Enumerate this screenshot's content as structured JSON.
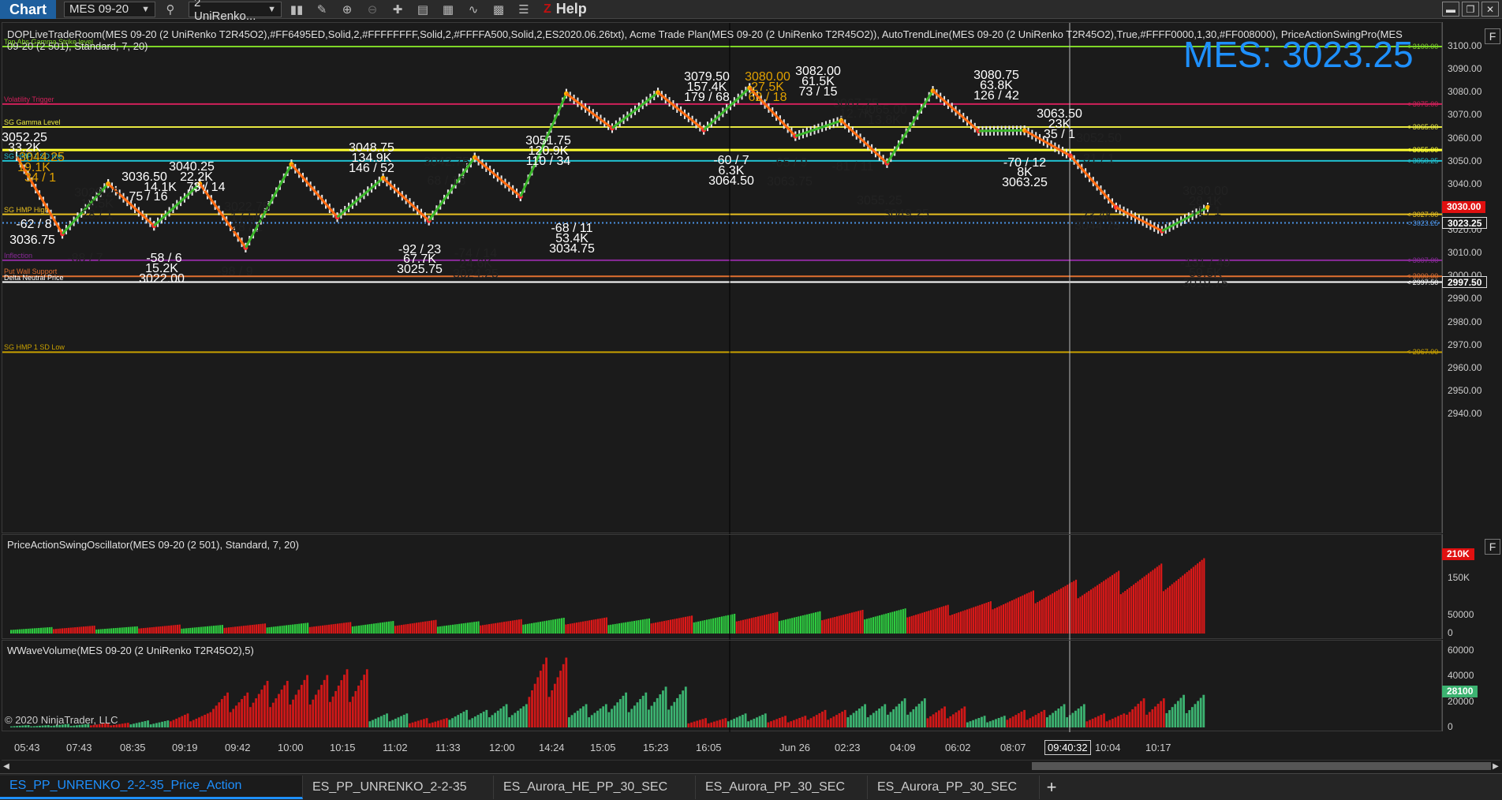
{
  "toolbar": {
    "title": "Chart",
    "instrument": "MES 09-20",
    "bar_type": "2 UniRenko...",
    "help": "Help",
    "z_label": "Z"
  },
  "main_panel": {
    "indicators_line1": "DOPLiveTradeRoom(MES 09-20 (2 UniRenko T2R45O2),#FF6495ED,Solid,2,#FFFFFFFF,Solid,2,#FFFFA500,Solid,2,ES2020.06.26txt), Acme Trade Plan(MES 09-20 (2 UniRenko T2R45O2)), AutoTrendLine(MES 09-20 (2 UniRenko T2R45O2),True,#FFFF0000,1,30,#FF008000), PriceActionSwingPro(MES",
    "indicators_line2": "09-20 (2 501), Standard, 7, 20)",
    "big_price": "MES: 3023.25",
    "price_axis": [
      "3100.00",
      "3090.00",
      "3080.00",
      "3070.00",
      "3060.00",
      "3050.00",
      "3040.00",
      "3030.00",
      "3020.00",
      "3010.00",
      "3000.00",
      "2990.00",
      "2980.00",
      "2970.00",
      "2960.00",
      "2950.00",
      "2940.00"
    ],
    "price_tags": [
      {
        "label": "3030.00",
        "color": "#e01010"
      },
      {
        "label": "3023.25",
        "color": "#1b1b1b"
      },
      {
        "label": "2997.50",
        "color": "#1b1b1b"
      }
    ],
    "levels": [
      {
        "name": "Top Abs Gamma Strike level",
        "value": "3100.00",
        "color": "#7fd628"
      },
      {
        "name": "Volatility Trigger",
        "value": "3075.00",
        "color": "#d0205a"
      },
      {
        "name": "SG Gamma Level",
        "value": "3065.00",
        "color": "#e8e840"
      },
      {
        "name": "",
        "value": "3055.00",
        "color": "#ffff30"
      },
      {
        "name": "SG HMP 1 SD line",
        "value": "3050.25",
        "color": "#20c0d0"
      },
      {
        "name": "SG HMP High",
        "value": "3027.00",
        "color": "#e8c020"
      },
      {
        "name": "",
        "value": "3023.25",
        "color": "#4a90e2"
      },
      {
        "name": "Inflection",
        "value": "3007.00",
        "color": "#8a2a9a"
      },
      {
        "name": "Put Wall Support",
        "value": "3000.00",
        "color": "#e07030"
      },
      {
        "name": "Delta Neutral Price",
        "value": "2997.50",
        "color": "#ffffff"
      },
      {
        "name": "SG HMP 1 SD Low",
        "value": "2967.00",
        "color": "#c8a000"
      }
    ],
    "swing_labels": [
      {
        "text": "3052.25",
        "color": "#fff"
      },
      {
        "text": "33.2K",
        "color": "#fff"
      },
      {
        "text": "3044.25",
        "color": "#e0a000"
      },
      {
        "text": "19.1K",
        "color": "#e0a000"
      },
      {
        "text": "34 / 1",
        "color": "#e0a000"
      },
      {
        "text": "3029.25",
        "color": "#222"
      },
      {
        "text": "19.5K",
        "color": "#222"
      },
      {
        "text": "28 / 1",
        "color": "#222"
      },
      {
        "text": "-62 / 8",
        "color": "#fff"
      },
      {
        "text": "3036.75",
        "color": "#fff"
      },
      {
        "text": "3036.50",
        "color": "#fff"
      },
      {
        "text": "14.1K",
        "color": "#fff"
      },
      {
        "text": "75 / 16",
        "color": "#fff"
      },
      {
        "text": "3040.25",
        "color": "#fff"
      },
      {
        "text": "22.2K",
        "color": "#fff"
      },
      {
        "text": "73 / 14",
        "color": "#fff"
      },
      {
        "text": "-88 / 7",
        "color": "#222"
      },
      {
        "text": "-58 / 6",
        "color": "#fff"
      },
      {
        "text": "15.2K",
        "color": "#fff"
      },
      {
        "text": "3022.00",
        "color": "#fff"
      },
      {
        "text": "3022.75",
        "color": "#222"
      },
      {
        "text": "17.5K",
        "color": "#222"
      },
      {
        "text": "28 / 1",
        "color": "#222"
      },
      {
        "text": "-98 / 9",
        "color": "#222"
      },
      {
        "text": "3048.75",
        "color": "#fff"
      },
      {
        "text": "134.9K",
        "color": "#fff"
      },
      {
        "text": "146 / 52",
        "color": "#fff"
      },
      {
        "text": "3042.75",
        "color": "#222"
      },
      {
        "text": "68 / 13",
        "color": "#222"
      },
      {
        "text": "-92 / 23",
        "color": "#fff"
      },
      {
        "text": "67.7K",
        "color": "#fff"
      },
      {
        "text": "3025.75",
        "color": "#fff"
      },
      {
        "text": "-74 / 14",
        "color": "#222"
      },
      {
        "text": "24.6K",
        "color": "#222"
      },
      {
        "text": "3024.25",
        "color": "#222"
      },
      {
        "text": "3051.75",
        "color": "#fff"
      },
      {
        "text": "120.9K",
        "color": "#fff"
      },
      {
        "text": "110 / 34",
        "color": "#fff"
      },
      {
        "text": "-68 / 11",
        "color": "#fff"
      },
      {
        "text": "53.4K",
        "color": "#fff"
      },
      {
        "text": "3034.75",
        "color": "#fff"
      },
      {
        "text": "3079.50",
        "color": "#fff"
      },
      {
        "text": "157.4K",
        "color": "#fff"
      },
      {
        "text": "179 / 68",
        "color": "#fff"
      },
      {
        "text": "3080.00",
        "color": "#e0a000"
      },
      {
        "text": "27.5K",
        "color": "#e0a000"
      },
      {
        "text": "62 / 18",
        "color": "#e0a000"
      },
      {
        "text": "3082.00",
        "color": "#fff"
      },
      {
        "text": "61.5K",
        "color": "#fff"
      },
      {
        "text": "73 / 15",
        "color": "#fff"
      },
      {
        "text": "-60 / 7",
        "color": "#fff"
      },
      {
        "text": "6.3K",
        "color": "#fff"
      },
      {
        "text": "3064.50",
        "color": "#fff"
      },
      {
        "text": "-65 / 9",
        "color": "#222"
      },
      {
        "text": "3063.75",
        "color": "#222"
      },
      {
        "text": "3067.75",
        "color": "#222"
      },
      {
        "text": "12.7K",
        "color": "#222"
      },
      {
        "text": "3065.00",
        "color": "#222"
      },
      {
        "text": "13.8K",
        "color": "#222"
      },
      {
        "text": "-81 / 11",
        "color": "#222"
      },
      {
        "text": "3055.25",
        "color": "#222"
      },
      {
        "text": "3049.25",
        "color": "#222"
      },
      {
        "text": "3080.75",
        "color": "#fff"
      },
      {
        "text": "63.8K",
        "color": "#fff"
      },
      {
        "text": "126 / 42",
        "color": "#fff"
      },
      {
        "text": "3063.50",
        "color": "#fff"
      },
      {
        "text": "23K",
        "color": "#fff"
      },
      {
        "text": "35 / 1",
        "color": "#fff"
      },
      {
        "text": "-70 / 12",
        "color": "#fff"
      },
      {
        "text": "8K",
        "color": "#fff"
      },
      {
        "text": "3063.25",
        "color": "#fff"
      },
      {
        "text": "3052.50",
        "color": "#222"
      },
      {
        "text": "31 / 1",
        "color": "#222"
      },
      {
        "text": "23.4K",
        "color": "#222"
      },
      {
        "text": "3044.75",
        "color": "#222"
      },
      {
        "text": "3030.00",
        "color": "#222"
      },
      {
        "text": "28.1K",
        "color": "#222"
      },
      {
        "text": "41 / 1",
        "color": "#222"
      },
      {
        "text": "-131 / 49",
        "color": "#222"
      },
      {
        "text": "59.5K",
        "color": "#222"
      },
      {
        "text": "3019.75",
        "color": "#222"
      }
    ]
  },
  "oscillator_panel": {
    "title": "PriceActionSwingOscillator(MES 09-20 (2 501), Standard, 7, 20)",
    "axis": [
      "150K",
      "50000",
      "0"
    ],
    "tag": "210K",
    "tag_color": "#e01010"
  },
  "volume_panel": {
    "title": "WWaveVolume(MES 09-20 (2 UniRenko T2R45O2),5)",
    "axis": [
      "60000",
      "40000",
      "20000",
      "0"
    ],
    "tag": "28100",
    "tag_color": "#3cb371",
    "copyright": "© 2020 NinjaTrader, LLC"
  },
  "time_axis": [
    "05:43",
    "07:43",
    "08:35",
    "09:19",
    "09:42",
    "10:00",
    "10:15",
    "11:02",
    "11:33",
    "12:00",
    "14:24",
    "15:05",
    "15:23",
    "16:05",
    "Jun 26",
    "02:23",
    "04:09",
    "06:02",
    "08:07",
    "10:04",
    "10:17"
  ],
  "cursor_time": "09:40:32",
  "f_button": "F",
  "tabs": [
    {
      "label": "ES_PP_UNRENKO_2-2-35_Price_Action",
      "active": true
    },
    {
      "label": "ES_PP_UNRENKO_2-2-35",
      "active": false
    },
    {
      "label": "ES_Aurora_HE_PP_30_SEC",
      "active": false
    },
    {
      "label": "ES_Aurora_PP_30_SEC",
      "active": false
    },
    {
      "label": "ES_Aurora_PP_30_SEC",
      "active": false
    }
  ],
  "tab_add": "+",
  "chart_data": {
    "type": "bar",
    "title": "",
    "y_axis_range": [
      2935,
      3105
    ],
    "swing_points": [
      {
        "price": 3052.25
      },
      {
        "price": 3018.5
      },
      {
        "price": 3040.25
      },
      {
        "price": 3022.0
      },
      {
        "price": 3040.25
      },
      {
        "price": 3012.5
      },
      {
        "price": 3048.75
      },
      {
        "price": 3025.75
      },
      {
        "price": 3042.75
      },
      {
        "price": 3024.25
      },
      {
        "price": 3051.75
      },
      {
        "price": 3034.75
      },
      {
        "price": 3079.5
      },
      {
        "price": 3064.5
      },
      {
        "price": 3080.0
      },
      {
        "price": 3063.75
      },
      {
        "price": 3082.0
      },
      {
        "price": 3061.0
      },
      {
        "price": 3067.75
      },
      {
        "price": 3049.25
      },
      {
        "price": 3080.75
      },
      {
        "price": 3063.25
      },
      {
        "price": 3063.5
      },
      {
        "price": 3052.5
      },
      {
        "price": 3030.0
      },
      {
        "price": 3019.75
      },
      {
        "price": 3030.0
      }
    ],
    "oscillator_values": [
      18,
      22,
      20,
      25,
      24,
      28,
      30,
      32,
      35,
      38,
      34,
      40,
      44,
      45,
      42,
      50,
      55,
      60,
      62,
      66,
      70,
      80,
      90,
      120,
      150,
      175,
      195,
      210
    ],
    "oscillator_colors": [
      "g",
      "r",
      "g",
      "r",
      "g",
      "r",
      "g",
      "r",
      "g",
      "r",
      "g",
      "r",
      "g",
      "r",
      "g",
      "r",
      "g",
      "r",
      "g",
      "r",
      "g",
      "r",
      "r",
      "r",
      "r",
      "r",
      "r",
      "r"
    ],
    "volume_values": [
      2,
      3,
      4,
      6,
      12,
      30,
      40,
      45,
      50,
      12,
      8,
      15,
      20,
      60,
      20,
      30,
      35,
      8,
      12,
      10,
      15,
      20,
      25,
      18,
      10,
      15,
      20,
      12,
      25,
      28
    ],
    "volume_colors": [
      "g",
      "g",
      "r",
      "g",
      "r",
      "r",
      "r",
      "r",
      "r",
      "g",
      "r",
      "g",
      "g",
      "r",
      "g",
      "g",
      "g",
      "r",
      "g",
      "r",
      "r",
      "g",
      "g",
      "r",
      "g",
      "r",
      "g",
      "r",
      "r",
      "g"
    ]
  }
}
